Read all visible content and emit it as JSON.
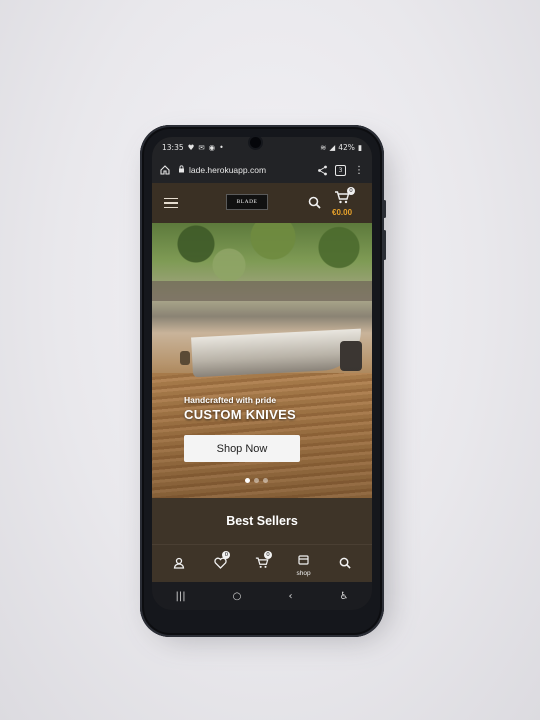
{
  "status_bar": {
    "time": "13:35",
    "left_icons": [
      "notification-icon",
      "email-icon",
      "whatsapp-icon",
      "dot-icon"
    ],
    "battery": "42%"
  },
  "browser": {
    "url": "lade.herokuapp.com",
    "tab_count": "3"
  },
  "header": {
    "logo_text": "BLADE",
    "cart_count": "0",
    "cart_total": "€0.00",
    "accent_color": "#e8a22a"
  },
  "hero": {
    "tagline": "Handcrafted with pride",
    "headline": "CUSTOM KNIVES",
    "cta_label": "Shop Now",
    "slide_count": 3,
    "active_slide": 1
  },
  "section": {
    "title": "Best Sellers"
  },
  "bottom_nav": {
    "wishlist_count": "0",
    "cart_count": "0",
    "shop_label": "shop"
  },
  "system_nav": {
    "recent": "|||",
    "home": "○",
    "back": "‹",
    "accessibility": "♿"
  }
}
